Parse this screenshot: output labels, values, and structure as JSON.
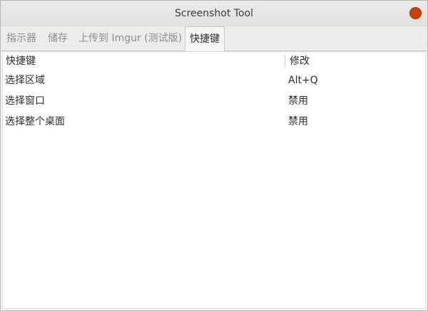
{
  "window": {
    "title": "Screenshot Tool"
  },
  "tabs": [
    {
      "label": "指示器"
    },
    {
      "label": "储存"
    },
    {
      "label": "上传到 Imgur (测试版)"
    },
    {
      "label": "快捷键",
      "active": true
    }
  ],
  "shortcuts": {
    "columns": [
      "快捷键",
      "修改"
    ],
    "rows": [
      {
        "action": "选择区域",
        "key": "Alt+Q"
      },
      {
        "action": "选择窗口",
        "key": "禁用"
      },
      {
        "action": "选择整个桌面",
        "key": "禁用"
      }
    ]
  },
  "colors": {
    "close_button": "#c7410b",
    "titlebar": "#e5e5e2",
    "content_bg": "#ffffff"
  },
  "icons": {
    "close": "close-icon"
  }
}
